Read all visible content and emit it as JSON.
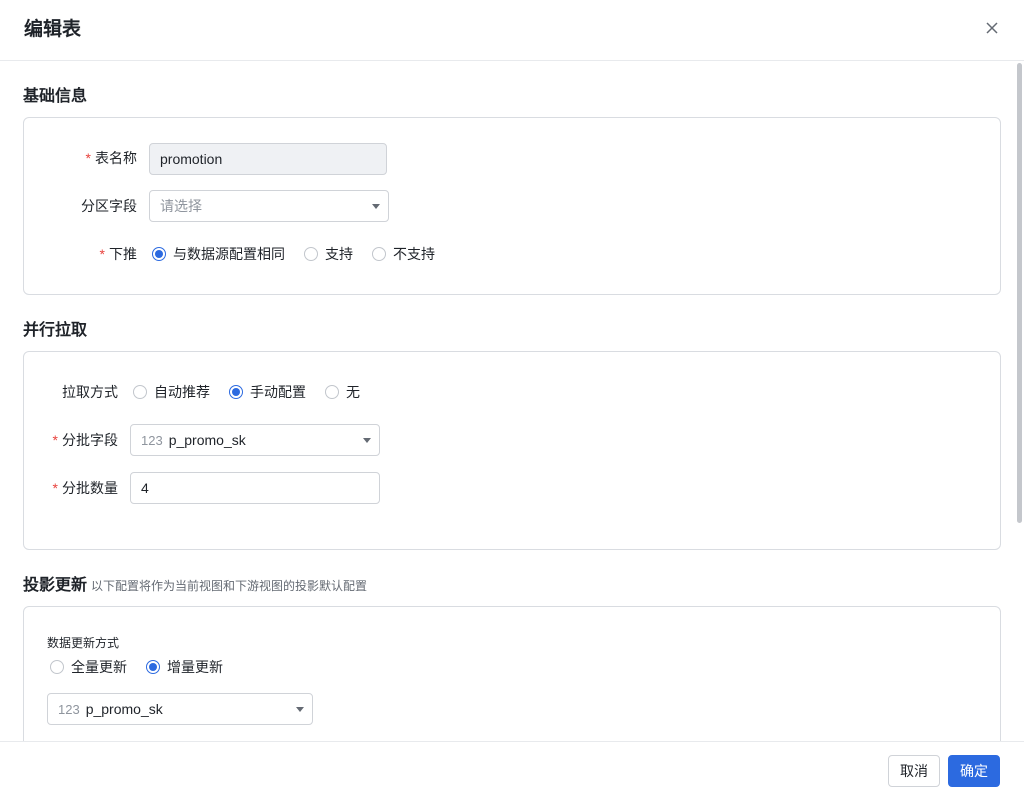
{
  "dialog": {
    "title": "编辑表"
  },
  "basic": {
    "title": "基础信息",
    "table_name_label": "表名称",
    "table_name_value": "promotion",
    "partition_label": "分区字段",
    "partition_placeholder": "请选择",
    "pushdown_label": "下推",
    "pushdown_options": [
      "与数据源配置相同",
      "支持",
      "不支持"
    ],
    "pushdown_selected": "与数据源配置相同"
  },
  "parallel": {
    "title": "并行拉取",
    "mode_label": "拉取方式",
    "mode_options": [
      "自动推荐",
      "手动配置",
      "无"
    ],
    "mode_selected": "手动配置",
    "batch_field_label": "分批字段",
    "batch_field_type": "123",
    "batch_field_value": "p_promo_sk",
    "batch_count_label": "分批数量",
    "batch_count_value": "4"
  },
  "projection": {
    "title": "投影更新",
    "subtitle": "以下配置将作为当前视图和下游视图的投影默认配置",
    "update_mode_label": "数据更新方式",
    "update_options": [
      "全量更新",
      "增量更新"
    ],
    "update_selected": "增量更新",
    "field_type": "123",
    "field_value": "p_promo_sk"
  },
  "footer": {
    "cancel_label": "取消",
    "ok_label": "确定"
  },
  "colors": {
    "primary": "#2c6ae0",
    "required": "#e8413c",
    "border": "#d9dce1"
  }
}
